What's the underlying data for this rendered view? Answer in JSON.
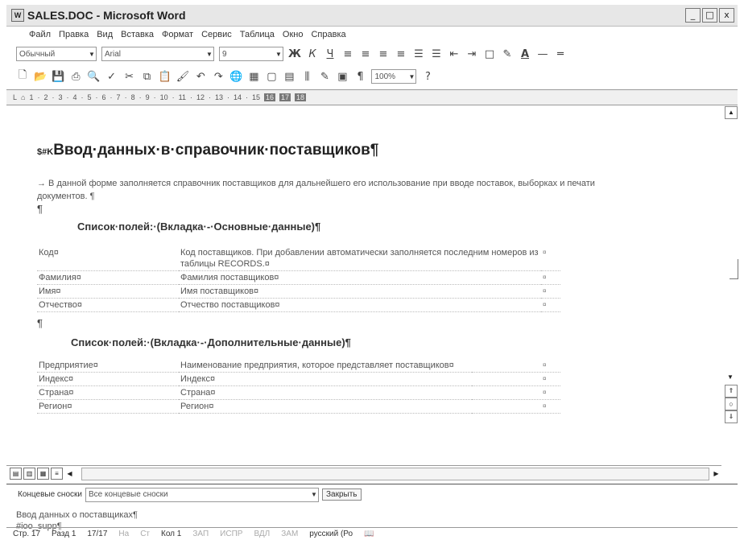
{
  "window": {
    "title": "SALES.DOC - Microsoft Word",
    "controls": [
      "_",
      "□",
      "x"
    ]
  },
  "menu": [
    "Файл",
    "Правка",
    "Вид",
    "Вставка",
    "Формат",
    "Сервис",
    "Таблица",
    "Окно",
    "Справка"
  ],
  "format_toolbar": {
    "style": "Обычный",
    "font": "Arial",
    "size": "9",
    "bold": "Ж",
    "italic": "К",
    "underline": "Ч"
  },
  "standard_toolbar": {
    "zoom": "100%"
  },
  "ruler": {
    "marks": [
      "1",
      "2",
      "3",
      "4",
      "5",
      "6",
      "7",
      "8",
      "9",
      "10",
      "11",
      "12",
      "13",
      "14",
      "15"
    ],
    "dark_marks": [
      "16",
      "17",
      "18"
    ]
  },
  "document": {
    "heading_mark": "$#K",
    "heading": "Ввод·данных·в·справочник·поставщиков¶",
    "intro": "→  В данной форме заполняется справочник поставщиков для дальнейшего его использование при вводе поставок, выборках и печати документов. ¶",
    "pilcrow": "¶",
    "section1": "Список·полей:·(Вкладка·-·Основные·данные)¶",
    "table1": [
      {
        "field": "Код¤",
        "desc": "Код поставщиков. При добавлении автоматически заполняется последним номеров из таблицы RECORDS.¤",
        "end": "¤"
      },
      {
        "field": "Фамилия¤",
        "desc": "Фамилия поставщиков¤",
        "end": "¤"
      },
      {
        "field": "Имя¤",
        "desc": "Имя поставщиков¤",
        "end": "¤"
      },
      {
        "field": "Отчество¤",
        "desc": "Отчество поставщиков¤",
        "end": "¤"
      }
    ],
    "section2": "Список·полей:·(Вкладка·-·Дополнительные·данные)¶",
    "table2": [
      {
        "field": "Предприятие¤",
        "desc": "Наименование предприятия, которое представляет поставщиков¤",
        "end": "¤"
      },
      {
        "field": "Индекс¤",
        "desc": "Индекс¤",
        "end": "¤"
      },
      {
        "field": "Страна¤",
        "desc": "Страна¤",
        "end": "¤"
      },
      {
        "field": "Регион¤",
        "desc": "Регион¤",
        "end": "¤"
      }
    ]
  },
  "notes_bar": {
    "label": "Концевые сноски",
    "select_value": "Все концевые сноски",
    "close": "Закрыть"
  },
  "notes": {
    "line1": "Ввод данных о поставщиках¶",
    "line2": "#ioo_supp¶"
  },
  "status": {
    "page": "Стр. 17",
    "section": "Разд 1",
    "pages": "17/17",
    "at": "На",
    "line": "Ст",
    "col": "Кол 1",
    "rec": "ЗАП",
    "trk": "ИСПР",
    "ext": "ВДЛ",
    "ovr": "ЗАМ",
    "lang": "русский (Ро"
  }
}
